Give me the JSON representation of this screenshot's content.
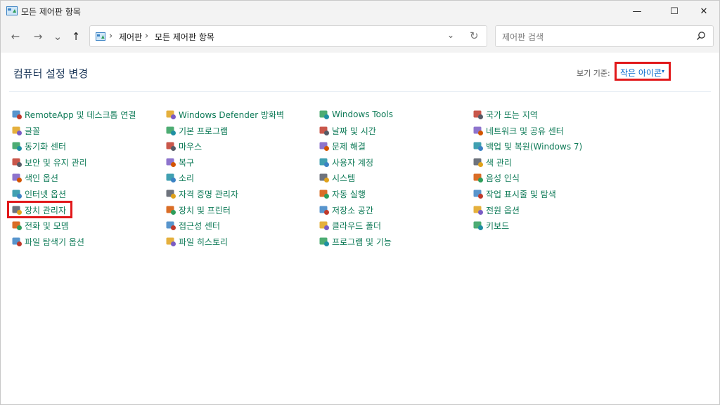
{
  "window": {
    "title": "모든 제어판 항목",
    "controls": {
      "minimize": "—",
      "maximize": "☐",
      "close": "✕"
    }
  },
  "nav": {
    "back": "←",
    "forward": "→",
    "recent": "⌄",
    "up": "↑",
    "breadcrumb": [
      "제어판",
      "모든 제어판 항목"
    ],
    "dropdown": "⌄",
    "refresh": "↻"
  },
  "search": {
    "placeholder": "제어판 검색"
  },
  "header": {
    "title": "컴퓨터 설정 변경",
    "view_by_label": "보기 기준:",
    "view_by_value": "작은 아이콘",
    "view_by_arrow": "▾"
  },
  "items": [
    {
      "label": "RemoteApp 및 데스크톱 연결",
      "icon": "remoteapp-icon"
    },
    {
      "label": "글꼴",
      "icon": "fonts-icon"
    },
    {
      "label": "동기화 센터",
      "icon": "sync-center-icon"
    },
    {
      "label": "보안 및 유지 관리",
      "icon": "security-flag-icon"
    },
    {
      "label": "색인 옵션",
      "icon": "indexing-icon"
    },
    {
      "label": "인터넷 옵션",
      "icon": "internet-options-icon"
    },
    {
      "label": "장치 관리자",
      "icon": "device-manager-icon"
    },
    {
      "label": "전화 및 모뎀",
      "icon": "phone-modem-icon"
    },
    {
      "label": "파일 탐색기 옵션",
      "icon": "folder-options-icon"
    },
    {
      "label": "Windows Defender 방화벽",
      "icon": "firewall-icon"
    },
    {
      "label": "기본 프로그램",
      "icon": "default-programs-icon"
    },
    {
      "label": "마우스",
      "icon": "mouse-icon"
    },
    {
      "label": "복구",
      "icon": "recovery-icon"
    },
    {
      "label": "소리",
      "icon": "sound-icon"
    },
    {
      "label": "자격 증명 관리자",
      "icon": "credential-manager-icon"
    },
    {
      "label": "장치 및 프린터",
      "icon": "devices-printers-icon"
    },
    {
      "label": "접근성 센터",
      "icon": "ease-of-access-icon"
    },
    {
      "label": "파일 히스토리",
      "icon": "file-history-icon"
    },
    {
      "label": "Windows Tools",
      "icon": "windows-tools-icon"
    },
    {
      "label": "날짜 및 시간",
      "icon": "date-time-icon"
    },
    {
      "label": "문제 해결",
      "icon": "troubleshooting-icon"
    },
    {
      "label": "사용자 계정",
      "icon": "user-accounts-icon"
    },
    {
      "label": "시스템",
      "icon": "system-icon"
    },
    {
      "label": "자동 실행",
      "icon": "autoplay-icon"
    },
    {
      "label": "저장소 공간",
      "icon": "storage-spaces-icon"
    },
    {
      "label": "클라우드 폴더",
      "icon": "work-folders-icon"
    },
    {
      "label": "프로그램 및 기능",
      "icon": "programs-features-icon"
    },
    {
      "label": "국가 또는 지역",
      "icon": "region-icon"
    },
    {
      "label": "네트워크 및 공유 센터",
      "icon": "network-sharing-icon"
    },
    {
      "label": "백업 및 복원(Windows 7)",
      "icon": "backup-restore-icon"
    },
    {
      "label": "색 관리",
      "icon": "color-management-icon"
    },
    {
      "label": "음성 인식",
      "icon": "speech-recognition-icon"
    },
    {
      "label": "작업 표시줄 및 탐색",
      "icon": "taskbar-navigation-icon"
    },
    {
      "label": "전원 옵션",
      "icon": "power-options-icon"
    },
    {
      "label": "키보드",
      "icon": "keyboard-icon"
    }
  ]
}
